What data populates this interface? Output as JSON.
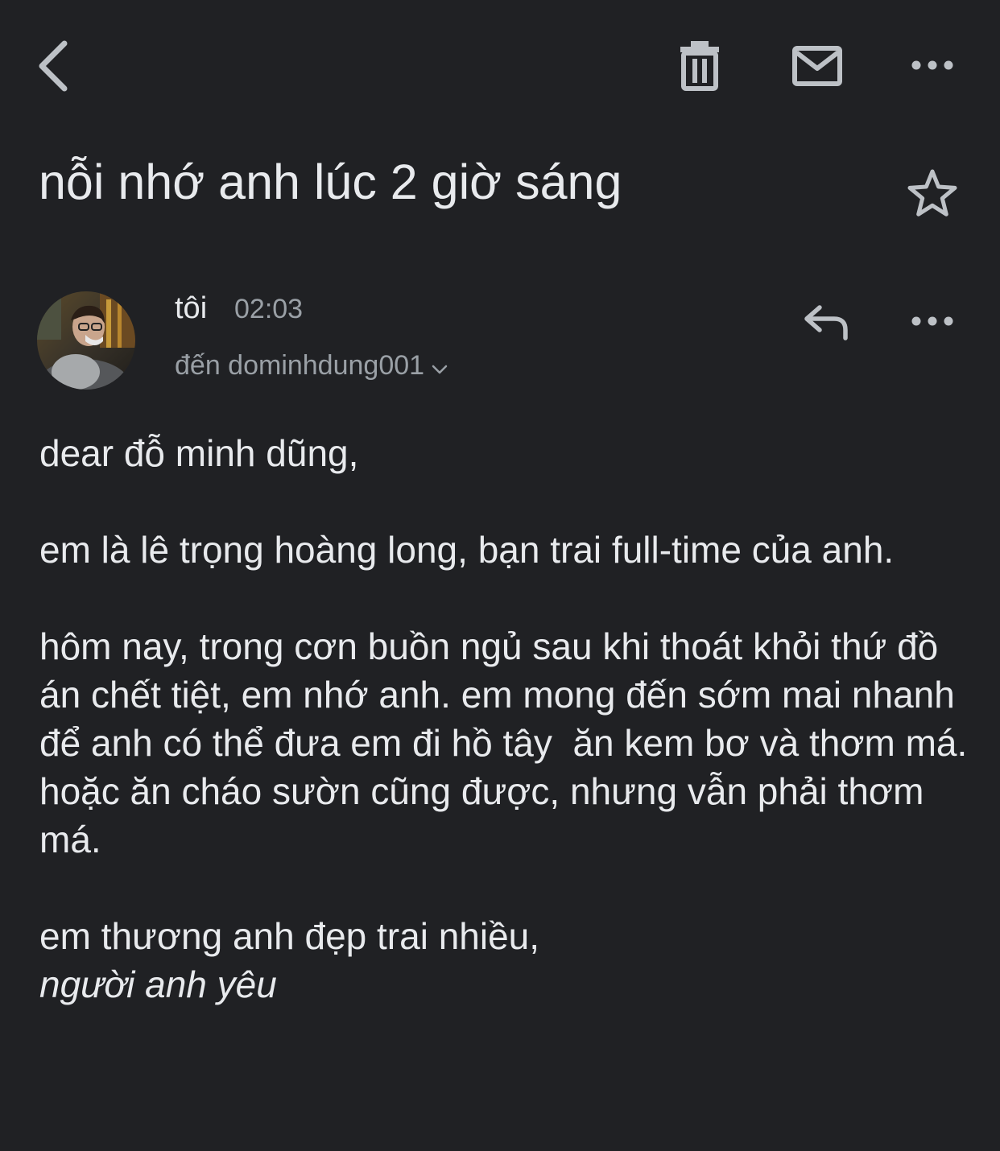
{
  "toolbar": {
    "back_icon": "chevron-left-icon",
    "delete_icon": "trash-icon",
    "mark_unread_icon": "mail-icon",
    "more_icon": "more-horizontal-icon"
  },
  "email": {
    "subject": "nỗi nhớ anh lúc 2 giờ sáng",
    "starred": false,
    "sender": {
      "name": "tôi",
      "time": "02:03",
      "recipient": "đến dominhdung001"
    },
    "body": {
      "greeting": "dear đỗ minh dũng,",
      "paragraph_1": "em là lê trọng hoàng long, bạn trai full-time của anh.",
      "paragraph_2": "hôm nay, trong cơn buồn ngủ sau khi thoát khỏi thứ đồ án chết tiệt, em nhớ anh. em mong đến sớm mai nhanh để anh có thể đưa em đi hồ tây  ăn kem bơ và thơm má. hoặc ăn cháo sườn cũng được, nhưng vẫn phải thơm má.",
      "closing": "em thương anh đẹp trai nhiều,",
      "signature": "người anh yêu"
    }
  },
  "colors": {
    "background": "#202124",
    "text_primary": "#e8eaed",
    "text_secondary": "#9aa0a6",
    "icon": "#bdc1c6"
  }
}
